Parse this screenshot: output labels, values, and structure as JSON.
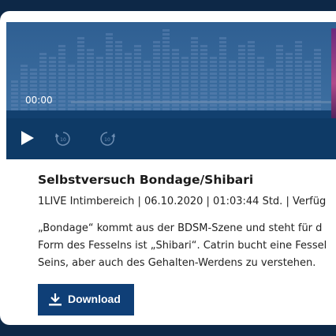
{
  "player": {
    "time": "00:00",
    "progress_fraction": 0,
    "accent": "#12406f"
  },
  "episode": {
    "title": "Selbstversuch Bondage/Shibari",
    "meta": "1LIVE Intimbereich | 06.10.2020 | 01:03:44 Std. | Verfüg",
    "description_lines": [
      "„Bondage“ kommt aus der BDSM-Szene und steht für d",
      "Form des Fesselns ist „Shibari“. Catrin bucht eine Fessel",
      "Seins, aber auch des Gehalten-Werdens zu verstehen."
    ]
  },
  "actions": {
    "download_label": "Download",
    "download_color": "#0f3f77"
  },
  "icons": {
    "play": "play-icon",
    "rewind": "rewind-10-icon",
    "forward": "forward-10-icon",
    "download": "download-icon"
  }
}
